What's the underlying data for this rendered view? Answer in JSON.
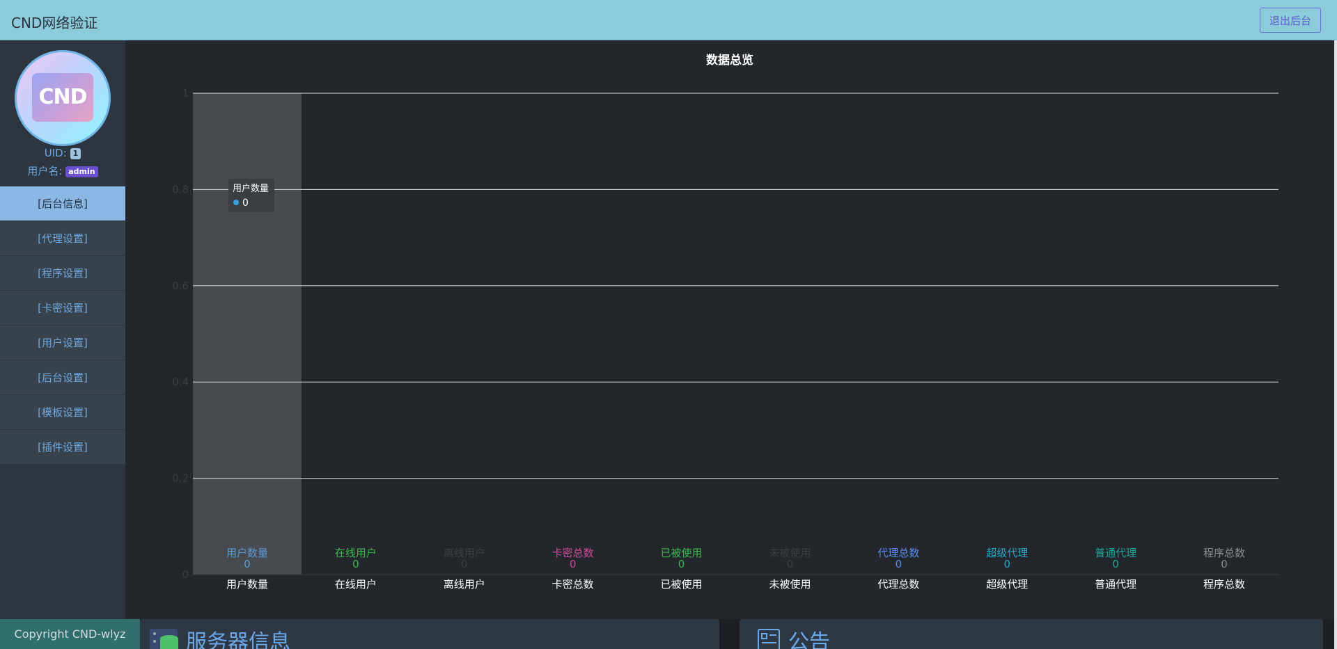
{
  "header": {
    "brand": "CND网络验证",
    "logout_label": "退出后台"
  },
  "sidebar": {
    "avatar_text": "CND",
    "uid_label": "UID:",
    "uid_value": "1",
    "username_label": "用户名:",
    "username_value": "admin",
    "menu": [
      {
        "label": "[后台信息]",
        "active": true
      },
      {
        "label": "[代理设置]"
      },
      {
        "label": "[程序设置]"
      },
      {
        "label": "[卡密设置]"
      },
      {
        "label": "[用户设置]"
      },
      {
        "label": "[后台设置]"
      },
      {
        "label": "[模板设置]"
      },
      {
        "label": "[插件设置]"
      }
    ]
  },
  "chart_data": {
    "type": "bar",
    "title": "数据总览",
    "categories": [
      "用户数量",
      "在线用户",
      "离线用户",
      "卡密总数",
      "已被使用",
      "未被使用",
      "代理总数",
      "超级代理",
      "普通代理",
      "程序总数"
    ],
    "values": [
      0,
      0,
      0,
      0,
      0,
      0,
      0,
      0,
      0,
      0
    ],
    "label_colors": [
      "#5b9bd5",
      "#3fb950",
      "#3b3f45",
      "#d14b9a",
      "#3fb950",
      "#3b3f45",
      "#5b8def",
      "#2aa6c8",
      "#1fa59a",
      "#8a8d93"
    ],
    "yticks": [
      "0",
      "0.2",
      "0.4",
      "0.6",
      "0.8",
      "1"
    ],
    "ylim": [
      0,
      1
    ],
    "grid": true,
    "highlighted_index": 0,
    "tooltip": {
      "title": "用户数量",
      "value": "0",
      "dot_color": "#3aa0e0"
    }
  },
  "footer": {
    "copyright": "Copyright CND-wlyz"
  },
  "panels": {
    "server_title": "服务器信息",
    "notice_title": "公告"
  }
}
